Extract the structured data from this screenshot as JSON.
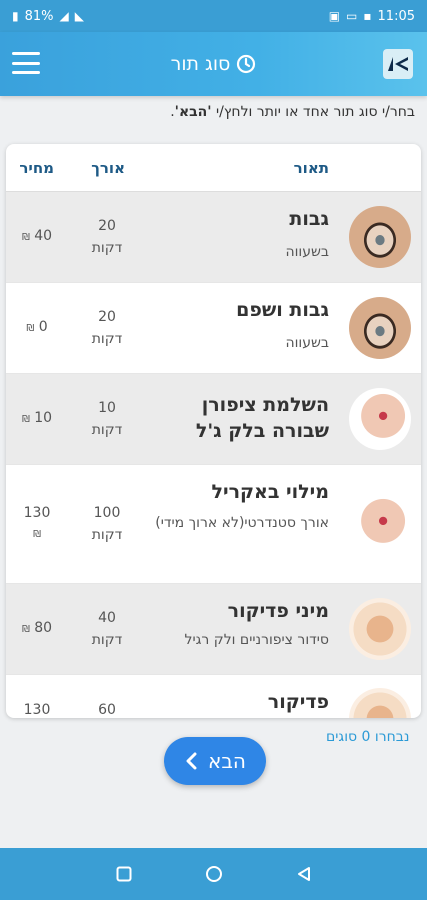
{
  "status_bar": {
    "battery": "81%",
    "time": "11:05",
    "battery_icon": "battery-icon",
    "signal_icon": "signal-icon"
  },
  "header": {
    "title": "סוג תור",
    "menu_icon": "menu-icon",
    "clock_icon": "clock-icon",
    "logo_icon": "app-logo-icon"
  },
  "instruction": {
    "text_before": "בחר/י סוג תור אחד או יותר ולחץ/י ",
    "bold": "'הבא'",
    "text_after": "."
  },
  "table": {
    "headers": {
      "description": "תאור",
      "length": "אורך",
      "price": "מחיר"
    },
    "rows": [
      {
        "name": "גבות",
        "sub": "בשעווה",
        "length": "20",
        "unit": "דקות",
        "price": "40",
        "currency": "₪",
        "image_icon": "eyebrow-image"
      },
      {
        "name": "גבות ושפם",
        "sub": "בשעווה",
        "length": "20",
        "unit": "דקות",
        "price": "0",
        "currency": "₪",
        "image_icon": "eyebrow-image"
      },
      {
        "name": "השלמת ציפורן שבורה בלק ג'ל",
        "sub": "",
        "length": "10",
        "unit": "דקות",
        "price": "10",
        "currency": "₪",
        "image_icon": "nail-image"
      },
      {
        "name": "מילוי באקריל",
        "sub": "אורך סטנדרטי(לא ארוך מידי)",
        "length": "100",
        "unit": "דקות",
        "price": "130",
        "currency": "₪",
        "image_icon": "nail-image"
      },
      {
        "name": "מיני פדיקור",
        "sub": "סידור ציפורניים ולק רגיל",
        "length": "40",
        "unit": "דקות",
        "price": "80",
        "currency": "₪",
        "image_icon": "foot-image"
      },
      {
        "name": "פדיקור",
        "sub": "",
        "length": "60",
        "unit": "",
        "price": "130",
        "currency": "",
        "image_icon": "foot-image"
      }
    ]
  },
  "footer": {
    "selected_count": "נבחרו 0 סוגים",
    "next_label": "הבא",
    "next_icon": "chevron-left-icon"
  },
  "nav_bar": {
    "recents_icon": "recents-icon",
    "home_icon": "home-icon",
    "back_icon": "back-icon"
  },
  "colors": {
    "primary": "#3a9ed4",
    "button": "#2f86e6",
    "header_text": "#1e5a86",
    "link": "#2b9ad6"
  }
}
